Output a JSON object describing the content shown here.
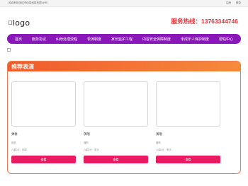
{
  "topbar": {
    "welcome": "欢迎来到深圳市信息科技有限公司！",
    "login": "注册",
    "register": "登录"
  },
  "header": {
    "logo_text": "logo",
    "hotline": "服务热线：13763344746"
  },
  "nav": {
    "items": [
      "首页",
      "服务协议",
      "纠纷处理流程",
      "表演制度",
      "家长监护工程",
      "内容安全保障制度",
      "未成年人保护制度",
      "帮助中心"
    ]
  },
  "section": {
    "title": "推荐表演"
  },
  "cards": [
    {
      "name": "弹奏",
      "category": "器类",
      "meta": "六翻0元 · 钢琴，",
      "button": "查看"
    },
    {
      "name": "演唱",
      "category": "器歌",
      "meta": "六翻0元 · 歌手",
      "button": "查看"
    },
    {
      "name": "演唱",
      "category": "器歌",
      "meta": "六翻0元 · 歌手，",
      "button": "查看"
    }
  ],
  "colors": {
    "nav_bg": "#8a18b8",
    "hotline": "#e8343a",
    "section_header": "#f25a2b",
    "button": "#e81b62"
  }
}
